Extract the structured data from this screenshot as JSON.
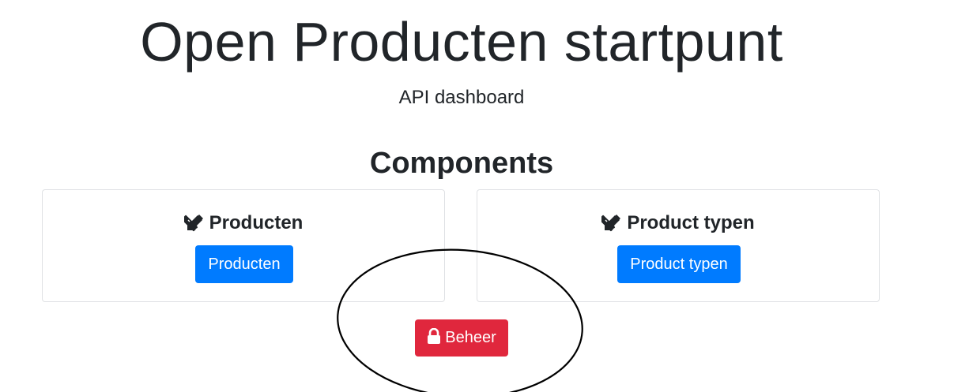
{
  "header": {
    "title": "Open Producten startpunt",
    "subtitle": "API dashboard"
  },
  "components": {
    "heading": "Components",
    "cards": [
      {
        "title": "Producten",
        "icon": "pencil-ruler-icon",
        "button_label": "Producten"
      },
      {
        "title": "Product typen",
        "icon": "pencil-ruler-icon",
        "button_label": "Product typen"
      }
    ]
  },
  "admin": {
    "button_label": "Beheer",
    "icon": "lock-icon"
  },
  "colors": {
    "primary": "#007bff",
    "danger": "#e0273d",
    "text": "#212529",
    "card_border": "#dfe1e4"
  }
}
